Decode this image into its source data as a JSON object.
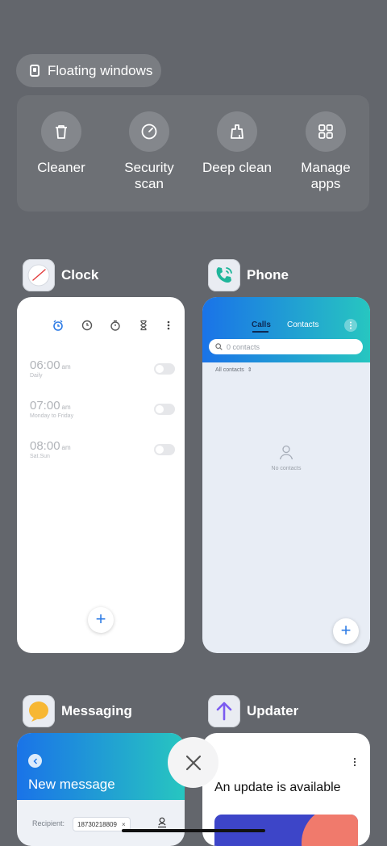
{
  "floating_windows": {
    "label": "Floating windows",
    "icon": "floating-window-icon"
  },
  "tools": [
    {
      "label": "Cleaner",
      "icon": "trash-icon"
    },
    {
      "label": "Security scan",
      "icon": "security-scan-icon"
    },
    {
      "label": "Deep clean",
      "icon": "deep-clean-icon"
    },
    {
      "label": "Manage apps",
      "icon": "grid-apps-icon"
    }
  ],
  "clock": {
    "name": "Clock",
    "alarms": [
      {
        "time": "06:00",
        "ampm": "am",
        "repeat": "Daily"
      },
      {
        "time": "07:00",
        "ampm": "am",
        "repeat": "Monday to Friday"
      },
      {
        "time": "08:00",
        "ampm": "am",
        "repeat": "Sat.Sun"
      }
    ]
  },
  "phone": {
    "name": "Phone",
    "tab_calls": "Calls",
    "tab_contacts": "Contacts",
    "search_placeholder": "0 contacts",
    "filter": "All contacts",
    "empty": "No contacts"
  },
  "messaging": {
    "name": "Messaging",
    "title": "New message",
    "recipient_label": "Recipient:",
    "recipient": "18730218809"
  },
  "updater": {
    "name": "Updater",
    "headline": "An update is available"
  },
  "colors": {
    "background": "#63666c",
    "accent": "#2d7be5",
    "phone_gradient_start": "#1a73e8",
    "phone_gradient_end": "#27c6c0"
  }
}
